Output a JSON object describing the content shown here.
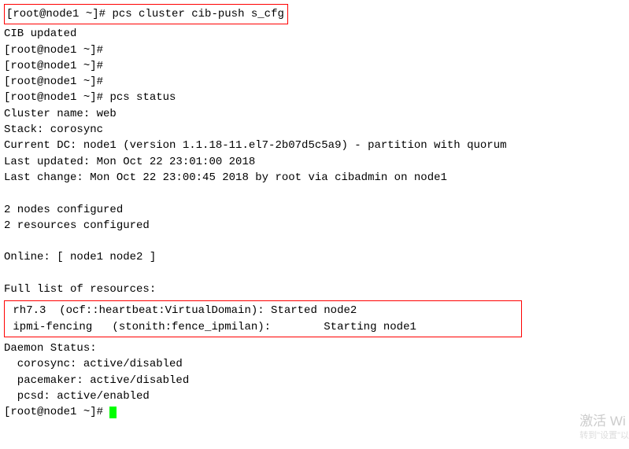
{
  "prompt": "[root@node1 ~]#",
  "cmd1": "pcs cluster cib-push s_cfg",
  "out_cib": "CIB updated",
  "cmd2": "pcs status",
  "status": {
    "cluster_name": "Cluster name: web",
    "stack": "Stack: corosync",
    "current_dc": "Current DC: node1 (version 1.1.18-11.el7-2b07d5c5a9) - partition with quorum",
    "last_updated": "Last updated: Mon Oct 22 23:01:00 2018",
    "last_change": "Last change: Mon Oct 22 23:00:45 2018 by root via cibadmin on node1",
    "nodes_cfg": "2 nodes configured",
    "res_cfg": "2 resources configured",
    "online": "Online: [ node1 node2 ]",
    "full_list_hdr": "Full list of resources:",
    "res1": " rh7.3  (ocf::heartbeat:VirtualDomain): Started node2",
    "res2": " ipmi-fencing   (stonith:fence_ipmilan):        Starting node1",
    "daemon_hdr": "Daemon Status:",
    "d_corosync": "  corosync: active/disabled",
    "d_pacemaker": "  pacemaker: active/disabled",
    "d_pcsd": "  pcsd: active/enabled"
  },
  "watermark": {
    "line1": "激活 Wi",
    "line2": "转到\"设置\"以"
  }
}
